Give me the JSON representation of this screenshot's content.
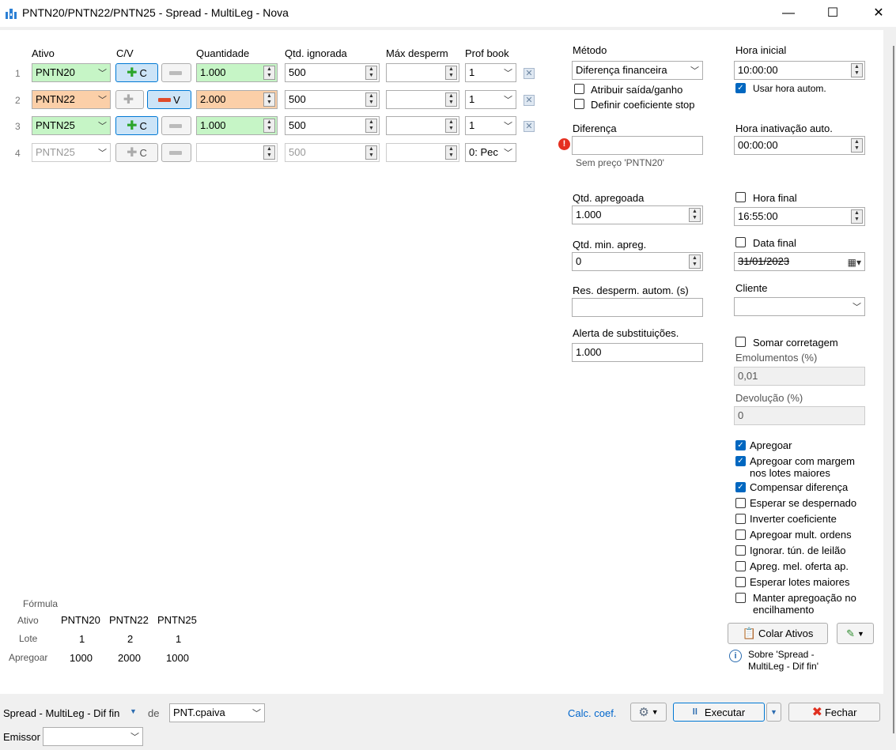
{
  "window": {
    "title": "PNTN20/PNTN22/PNTN25 - Spread - MultiLeg - Nova",
    "minimize": "—",
    "maximize": "☐",
    "close": "✕"
  },
  "grid": {
    "headers": {
      "ativo": "Ativo",
      "cv": "C/V",
      "quantidade": "Quantidade",
      "qtd_ignorada": "Qtd. ignorada",
      "max_desperm": "Máx desperm",
      "prof_book": "Prof book"
    },
    "rows": [
      {
        "num": "1",
        "ativo": "PNTN20",
        "c_label": "C",
        "v_label": "",
        "quantidade": "1.000",
        "qtd_ignorada": "500",
        "max_desperm": "",
        "prof_book": "1"
      },
      {
        "num": "2",
        "ativo": "PNTN22",
        "c_label": "",
        "v_label": "V",
        "quantidade": "2.000",
        "qtd_ignorada": "500",
        "max_desperm": "",
        "prof_book": "1"
      },
      {
        "num": "3",
        "ativo": "PNTN25",
        "c_label": "C",
        "v_label": "",
        "quantidade": "1.000",
        "qtd_ignorada": "500",
        "max_desperm": "",
        "prof_book": "1"
      },
      {
        "num": "4",
        "ativo": "PNTN25",
        "c_label": "C",
        "v_label": "",
        "quantidade": "",
        "qtd_ignorada": "500",
        "max_desperm": "",
        "prof_book": "0: Pec"
      }
    ]
  },
  "metodo": {
    "label": "Método",
    "value": "Diferença financeira"
  },
  "atribuir_saida": "Atribuir saída/ganho",
  "definir_coef": "Definir coeficiente stop",
  "diferenca": {
    "label": "Diferença",
    "value": "",
    "error": "Sem preço 'PNTN20'"
  },
  "qtd_apregoada": {
    "label": "Qtd. apregoada",
    "value": "1.000"
  },
  "qtd_min": {
    "label": "Qtd. min. apreg.",
    "value": "0"
  },
  "res_desperm": {
    "label": "Res. desperm. autom. (s)",
    "value": ""
  },
  "alerta": {
    "label": "Alerta de substituições.",
    "value": "1.000"
  },
  "hora_inicial": {
    "label": "Hora inicial",
    "value": "10:00:00",
    "auto_label": "Usar hora autom."
  },
  "hora_inativacao": {
    "label": "Hora inativação auto.",
    "value": "00:00:00"
  },
  "hora_final": {
    "label": "Hora final",
    "value": "16:55:00"
  },
  "data_final": {
    "label": "Data final",
    "value": "31/01/2023"
  },
  "cliente": {
    "label": "Cliente",
    "value": ""
  },
  "somar_corretagem": "Somar corretagem",
  "emolumentos": {
    "label": "Emolumentos (%)",
    "value": "0,01"
  },
  "devolucao": {
    "label": "Devolução (%)",
    "value": "0"
  },
  "options": [
    {
      "label": "Apregoar",
      "checked": true
    },
    {
      "label": "Apregoar com margem nos lotes maiores",
      "checked": true
    },
    {
      "label": "Compensar diferença",
      "checked": true
    },
    {
      "label": "Esperar se despernado",
      "checked": false
    },
    {
      "label": "Inverter coeficiente",
      "checked": false
    },
    {
      "label": "Apregoar mult. ordens",
      "checked": false
    },
    {
      "label": "Ignorar. tún. de leilão",
      "checked": false
    },
    {
      "label": "Apreg. mel. oferta ap.",
      "checked": false
    },
    {
      "label": "Esperar lotes maiores",
      "checked": false
    },
    {
      "label": "Manter apregoação no encilhamento",
      "checked": false
    }
  ],
  "colar_ativos": "Colar Ativos",
  "sobre": "Sobre 'Spread - MultiLeg - Dif fin'",
  "formula": {
    "title": "Fórmula",
    "row_labels": {
      "ativo": "Ativo",
      "lote": "Lote",
      "apregoar": "Apregoar"
    },
    "cols": [
      {
        "ativo": "PNTN20",
        "lote": "1",
        "apregoar": "1000"
      },
      {
        "ativo": "PNTN22",
        "lote": "2",
        "apregoar": "2000"
      },
      {
        "ativo": "PNTN25",
        "lote": "1",
        "apregoar": "1000"
      }
    ]
  },
  "footer": {
    "strategy": "Spread - MultiLeg - Dif fin",
    "de": "de",
    "account": "PNT.cpaiva",
    "calc_coef": "Calc. coef.",
    "executar": "Executar",
    "fechar": "Fechar",
    "emissor_label": "Emissor",
    "emissor_value": ""
  },
  "colors": {
    "buy_green": "#c6f5c6",
    "sell_orange": "#fbcfa8",
    "accent": "#0067c0",
    "error": "#e53020"
  }
}
